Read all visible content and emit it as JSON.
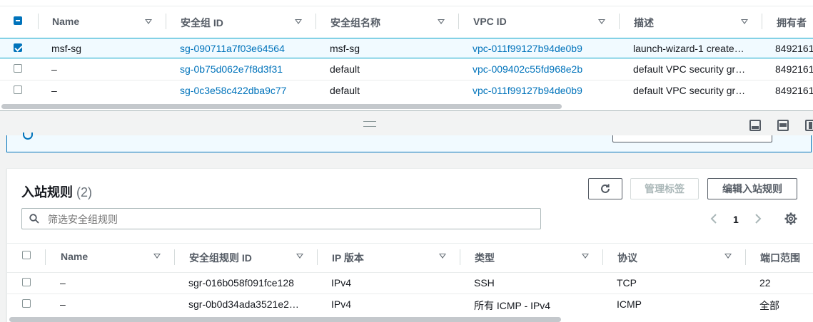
{
  "top_table": {
    "columns": [
      "Name",
      "安全组 ID",
      "安全组名称",
      "VPC ID",
      "描述",
      "拥有者"
    ],
    "rows": [
      {
        "name": "msf-sg",
        "sg_id": "sg-090711a7f03e64564",
        "sg_name": "msf-sg",
        "vpc_id": "vpc-011f99127b94de0b9",
        "desc": "launch-wizard-1 create…",
        "owner": "8492161",
        "checked": true
      },
      {
        "name": "–",
        "sg_id": "sg-0b75d062e7f8d3f31",
        "sg_name": "default",
        "vpc_id": "vpc-009402c55fd968e2b",
        "desc": "default VPC security gr…",
        "owner": "8492161",
        "checked": false
      },
      {
        "name": "–",
        "sg_id": "sg-0c3e58c422dba9c77",
        "sg_name": "default",
        "vpc_id": "vpc-011f99127b94de0b9",
        "desc": "default VPC security gr…",
        "owner": "8492161",
        "checked": false
      }
    ]
  },
  "panel_icons": [
    "panel-bottom-icon",
    "panel-split-icon",
    "panel-side-icon"
  ],
  "inbound": {
    "title": "入站规则",
    "count": "(2)",
    "refresh_icon": "refresh-icon",
    "manage_tags_label": "管理标签",
    "edit_rules_label": "编辑入站规则",
    "search_placeholder": "筛选安全组规则",
    "page_number": "1",
    "columns": [
      "Name",
      "安全组规则 ID",
      "IP 版本",
      "类型",
      "协议",
      "端口范围"
    ],
    "rows": [
      {
        "name": "–",
        "rule_id": "sgr-016b058f091fce128",
        "ip_version": "IPv4",
        "type": "SSH",
        "protocol": "TCP",
        "port": "22"
      },
      {
        "name": "–",
        "rule_id": "sgr-0b0d34ada3521e2…",
        "ip_version": "IPv4",
        "type": "所有 ICMP - IPv4",
        "protocol": "ICMP",
        "port": "全部"
      }
    ]
  },
  "colors": {
    "link": "#0073bb",
    "selected_row": "#f1faff",
    "accent": "#0073bb"
  }
}
